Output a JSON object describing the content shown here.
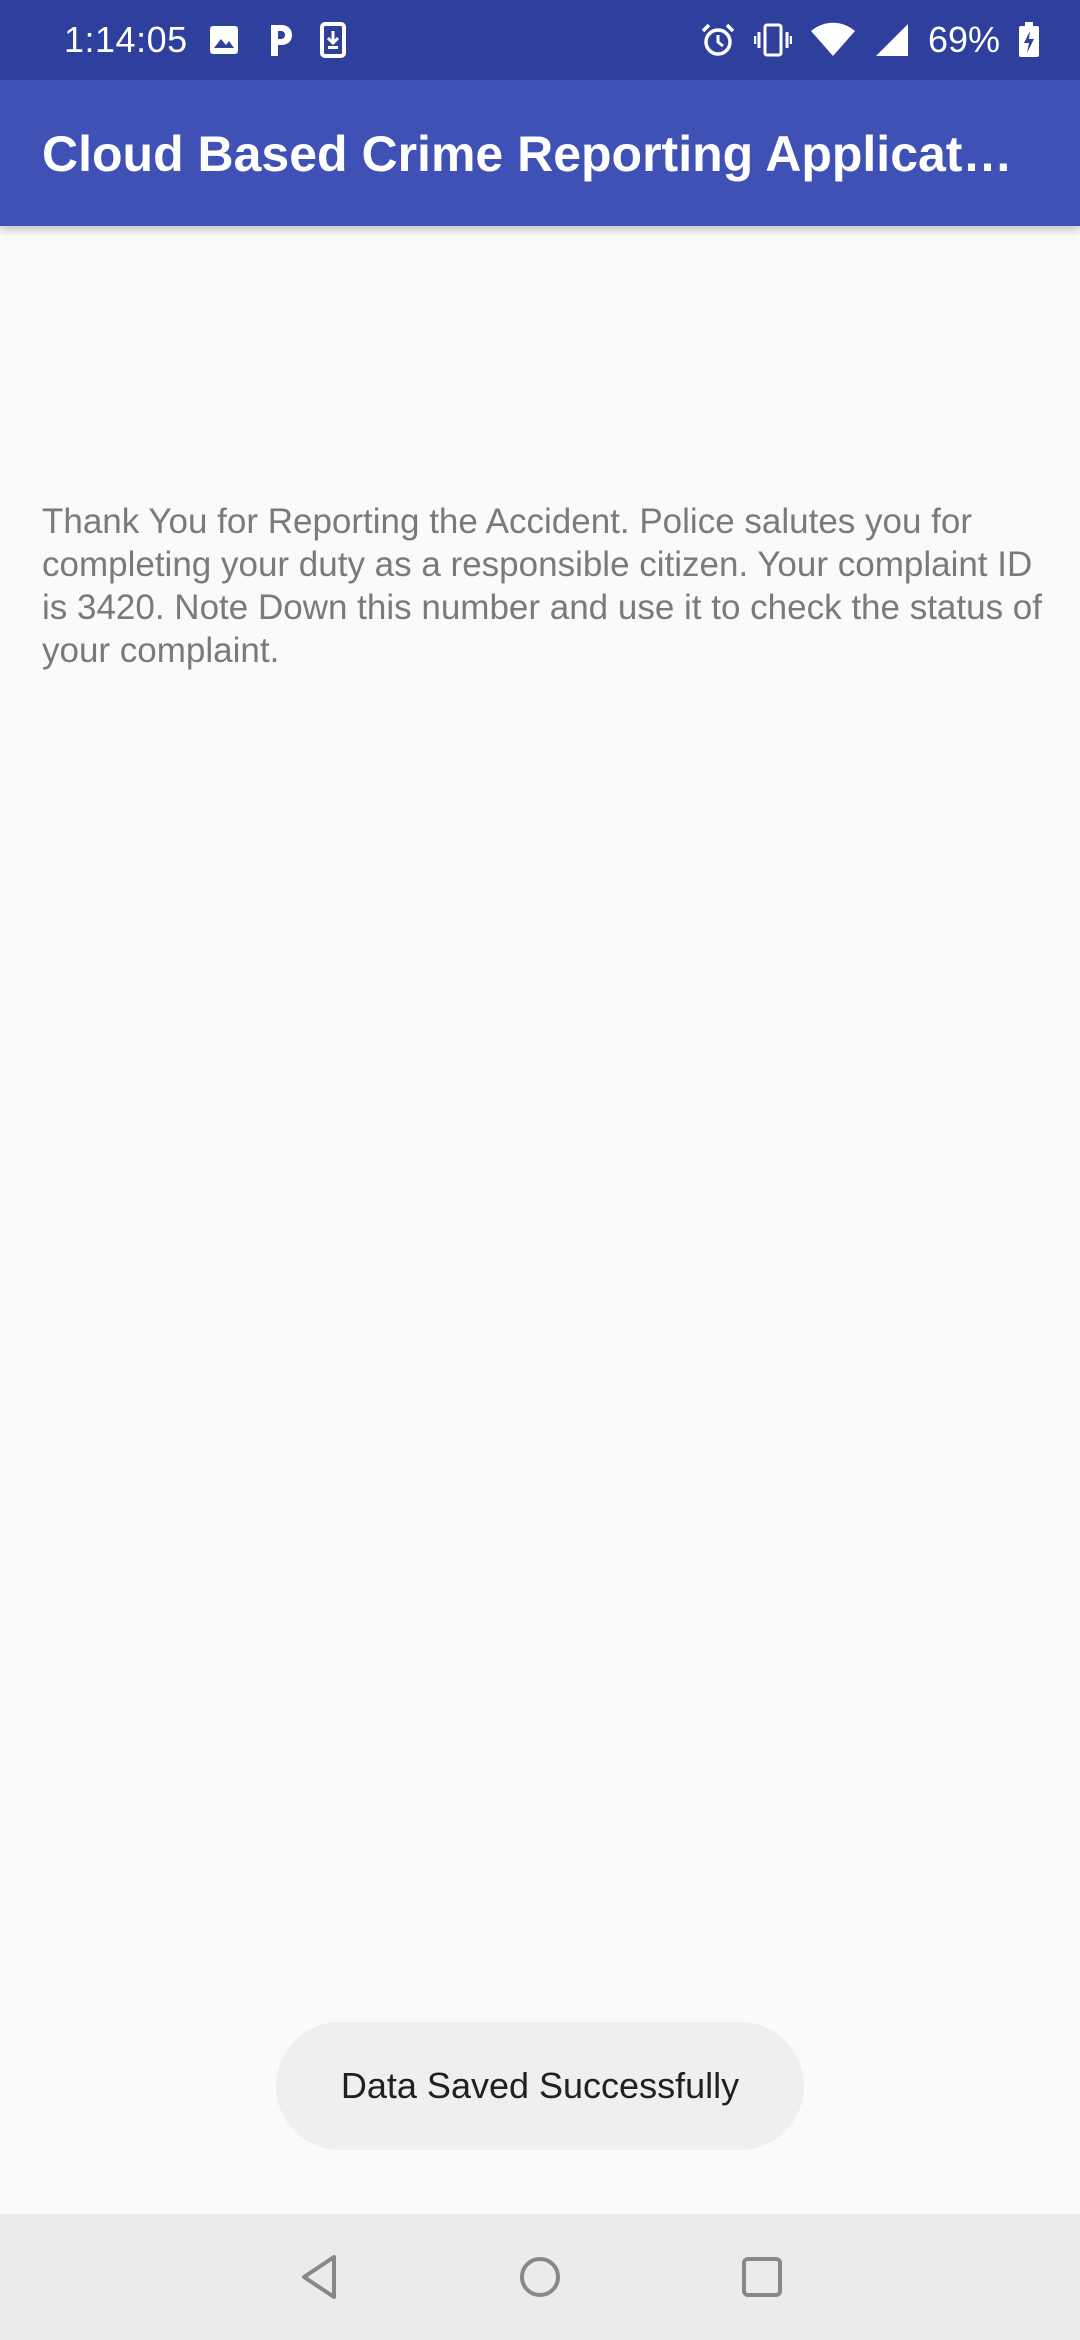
{
  "status_bar": {
    "time": "1:14:05",
    "battery_percent": "69%",
    "left_icons": [
      "gallery-icon",
      "parking-p-icon",
      "download-icon"
    ],
    "right_icons": [
      "alarm-icon",
      "vibrate-icon",
      "wifi-icon",
      "signal-icon",
      "battery-icon"
    ],
    "color": "#2f3f9e"
  },
  "app_bar": {
    "title": "Cloud Based Crime Reporting Application",
    "color": "#3f51b5"
  },
  "main": {
    "message": "Thank You for Reporting the Accident. Police salutes you for completing your duty as a responsible citizen. Your complaint ID is 3420. Note Down this number and use it to check the status of your complaint.",
    "complaint_id": "3420"
  },
  "toast": {
    "text": "Data Saved Successfully"
  },
  "nav_bar": {
    "buttons": [
      "back-icon",
      "home-icon",
      "recents-icon"
    ]
  }
}
